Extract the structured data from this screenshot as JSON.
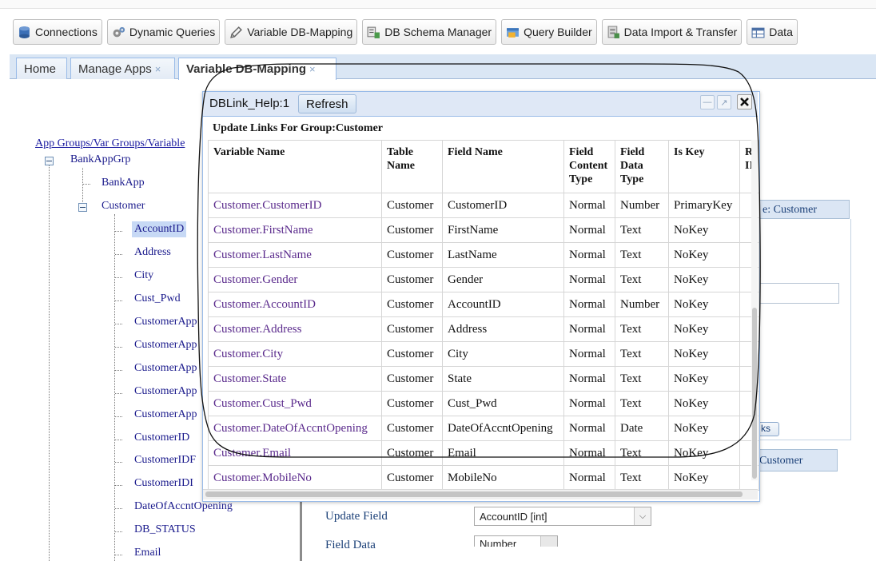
{
  "toolbar": {
    "items": [
      {
        "label": "Connections",
        "icon": "database-icon"
      },
      {
        "label": "Dynamic Queries",
        "icon": "gears-icon"
      },
      {
        "label": "Variable DB-Mapping",
        "icon": "pencil-icon"
      },
      {
        "label": "DB Schema Manager",
        "icon": "schema-icon"
      },
      {
        "label": "Query Builder",
        "icon": "query-builder-icon"
      },
      {
        "label": "Data Import & Transfer",
        "icon": "import-icon"
      },
      {
        "label": "Data",
        "icon": "table-icon"
      }
    ]
  },
  "tabs": [
    {
      "label": "Home",
      "closable": false
    },
    {
      "label": "Manage Apps",
      "closable": true,
      "close": "×"
    },
    {
      "label": "Variable DB-Mapping",
      "closable": true,
      "active": true,
      "close": "×"
    }
  ],
  "tree": {
    "root_link": "App Groups/Var Groups/Variable",
    "group": "BankAppGrp",
    "app": "BankApp",
    "var_group": "Customer",
    "selected": "AccountID",
    "variables": [
      "AccountID",
      "Address",
      "City",
      "Cust_Pwd",
      "CustomerApp",
      "CustomerApp",
      "CustomerApp",
      "CustomerApp",
      "CustomerApp",
      "CustomerID",
      "CustomerIDF",
      "CustomerIDI",
      "DateOfAccntOpening",
      "DB_STATUS",
      "Email"
    ]
  },
  "right_panel": {
    "header": "e: Customer",
    "button": "ks",
    "header2": "Customer"
  },
  "mid_form": {
    "update_field_label": "Update Field",
    "update_field_value": "AccountID [int]",
    "next_label": "Field Data Type",
    "next_value": "Number"
  },
  "dialog": {
    "title": "DBLink_Help:1",
    "refresh_label": "Refresh",
    "group_heading": "Update Links For Group:Customer",
    "columns": [
      "Variable Name",
      "Table Name",
      "Field Name",
      "Field Content Type",
      "Field Data Type",
      "Is Key",
      "R II"
    ],
    "rows": [
      [
        "Customer.CustomerID",
        "Customer",
        "CustomerID",
        "Normal",
        "Number",
        "PrimaryKey"
      ],
      [
        "Customer.FirstName",
        "Customer",
        "FirstName",
        "Normal",
        "Text",
        "NoKey"
      ],
      [
        "Customer.LastName",
        "Customer",
        "LastName",
        "Normal",
        "Text",
        "NoKey"
      ],
      [
        "Customer.Gender",
        "Customer",
        "Gender",
        "Normal",
        "Text",
        "NoKey"
      ],
      [
        "Customer.AccountID",
        "Customer",
        "AccountID",
        "Normal",
        "Number",
        "NoKey"
      ],
      [
        "Customer.Address",
        "Customer",
        "Address",
        "Normal",
        "Text",
        "NoKey"
      ],
      [
        "Customer.City",
        "Customer",
        "City",
        "Normal",
        "Text",
        "NoKey"
      ],
      [
        "Customer.State",
        "Customer",
        "State",
        "Normal",
        "Text",
        "NoKey"
      ],
      [
        "Customer.Cust_Pwd",
        "Customer",
        "Cust_Pwd",
        "Normal",
        "Text",
        "NoKey"
      ],
      [
        "Customer.DateOfAccntOpening",
        "Customer",
        "DateOfAccntOpening",
        "Normal",
        "Date",
        "NoKey"
      ],
      [
        "Customer.Email",
        "Customer",
        "Email",
        "Normal",
        "Text",
        "NoKey"
      ],
      [
        "Customer.MobileNo",
        "Customer",
        "MobileNo",
        "Normal",
        "Text",
        "NoKey"
      ]
    ]
  },
  "colors": {
    "tab_bar": "#dae6f4",
    "dialog_header": "#dfe8f6",
    "link": "#1a1aa0",
    "variable_text": "#5a2a8c",
    "selected_node": "#c7d9f5"
  }
}
